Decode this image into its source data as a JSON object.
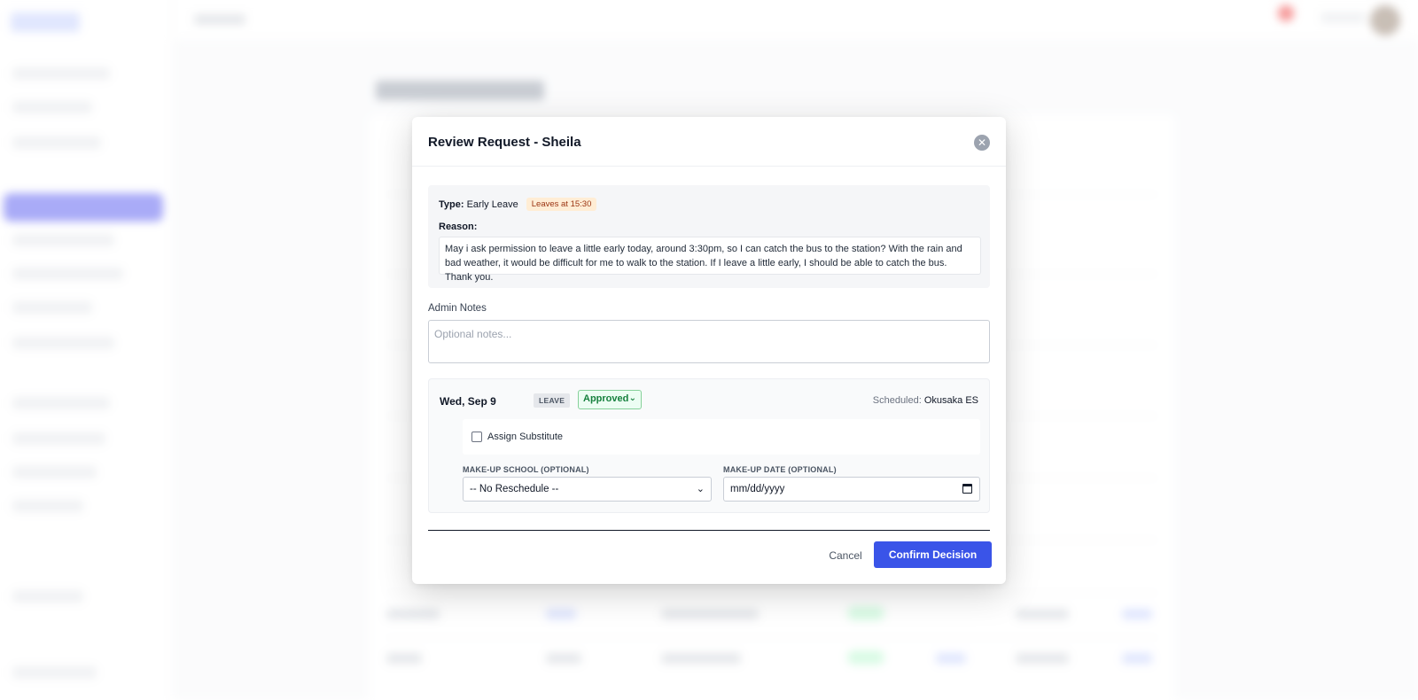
{
  "modal": {
    "title": "Review Request - Sheila",
    "close_icon": "close-icon",
    "type_label": "Type:",
    "type_value": "Early Leave",
    "type_badge": "Leaves at 15:30",
    "reason_label": "Reason:",
    "reason_text": "May i ask permission to leave a little early today, around 3:30pm, so I can catch the bus to the station? With the rain and bad weather, it would be difficult for me to walk to the station. If I leave a little early, I should be able to catch the bus. Thank you.",
    "notes_label": "Admin Notes",
    "notes_placeholder": "Optional notes...",
    "notes_value": "",
    "day": {
      "date": "Wed, Sep 9",
      "tag": "LEAVE",
      "status": "Approved",
      "scheduled_label": "Scheduled:",
      "scheduled_value": "Okusaka ES",
      "assign_substitute_label": "Assign Substitute",
      "assign_substitute_checked": false,
      "makeup_school_label": "MAKE-UP SCHOOL (OPTIONAL)",
      "makeup_school_value": "-- No Reschedule --",
      "makeup_date_label": "MAKE-UP DATE (OPTIONAL)",
      "makeup_date_value": "mm/dd/yyyy"
    },
    "cancel_label": "Cancel",
    "confirm_label": "Confirm Decision"
  },
  "colors": {
    "primary": "#3a54e8",
    "approved_green": "#15803d",
    "badge_orange": "#9a3412"
  }
}
